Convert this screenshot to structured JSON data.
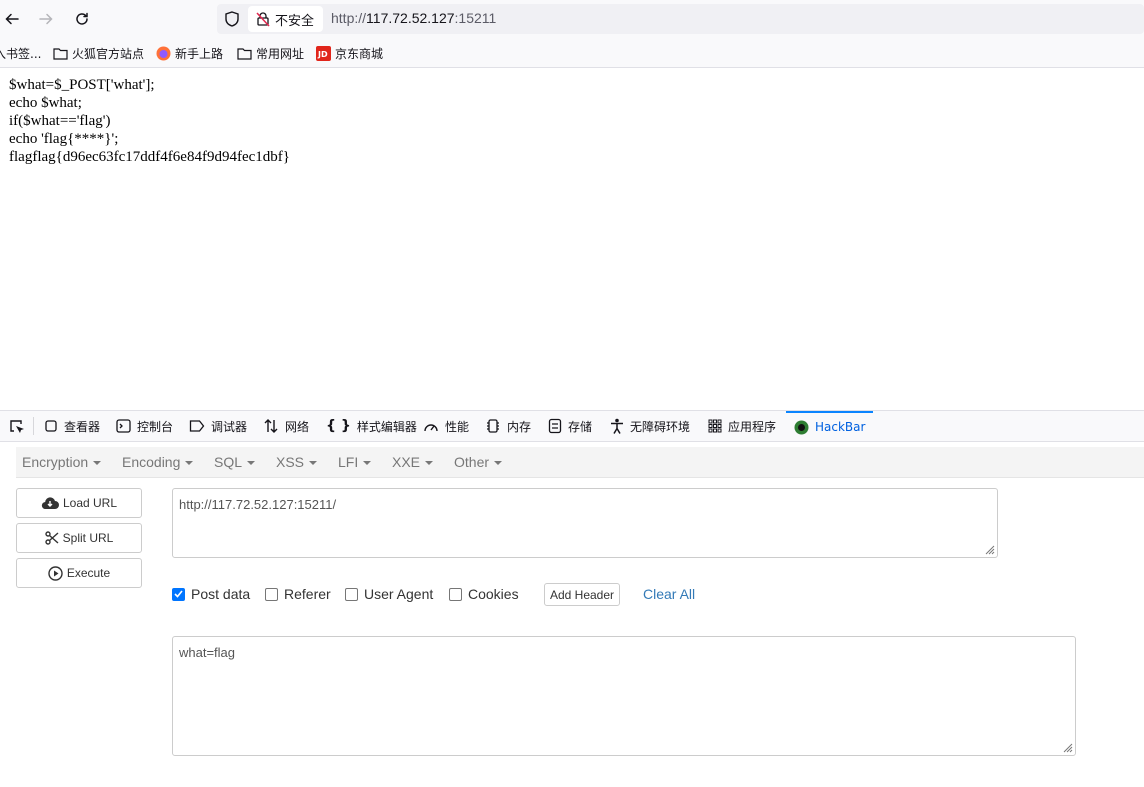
{
  "browser": {
    "security_label": "不安全",
    "url_scheme": "http://",
    "url_host": "117.72.52.127",
    "url_port": ":15211"
  },
  "bookmarks": [
    {
      "label": "入书签..."
    },
    {
      "label": "火狐官方站点"
    },
    {
      "label": "新手上路"
    },
    {
      "label": "常用网址"
    },
    {
      "label": "京东商城"
    }
  ],
  "page": {
    "lines": [
      "$what=$_POST['what'];",
      "echo $what;",
      "if($what=='flag')",
      "echo 'flag{****}';",
      "flagflag{d96ec63fc17ddf4f6e84f9d94fec1dbf}"
    ]
  },
  "devtools": {
    "tabs": [
      {
        "label": "查看器"
      },
      {
        "label": "控制台"
      },
      {
        "label": "调试器"
      },
      {
        "label": "网络"
      },
      {
        "label": "样式编辑器"
      },
      {
        "label": "性能"
      },
      {
        "label": "内存"
      },
      {
        "label": "存储"
      },
      {
        "label": "无障碍环境"
      },
      {
        "label": "应用程序"
      },
      {
        "label": "HackBar"
      }
    ],
    "active_tab": "HackBar"
  },
  "hackbar": {
    "menu": [
      {
        "label": "Encryption"
      },
      {
        "label": "Encoding"
      },
      {
        "label": "SQL"
      },
      {
        "label": "XSS"
      },
      {
        "label": "LFI"
      },
      {
        "label": "XXE"
      },
      {
        "label": "Other"
      }
    ],
    "buttons": {
      "load_url": "Load URL",
      "split_url": "Split URL",
      "execute": "Execute"
    },
    "url_value": "http://117.72.52.127:15211/",
    "options": {
      "post_data": {
        "label": "Post data",
        "checked": true
      },
      "referer": {
        "label": "Referer",
        "checked": false
      },
      "user_agent": {
        "label": "User Agent",
        "checked": false
      },
      "cookies": {
        "label": "Cookies",
        "checked": false
      }
    },
    "add_header": "Add Header",
    "clear_all": "Clear All",
    "post_value": "what=flag"
  },
  "colors": {
    "accent": "#0a84ff",
    "link": "#337ab7",
    "checkbox": "#0075ff"
  }
}
